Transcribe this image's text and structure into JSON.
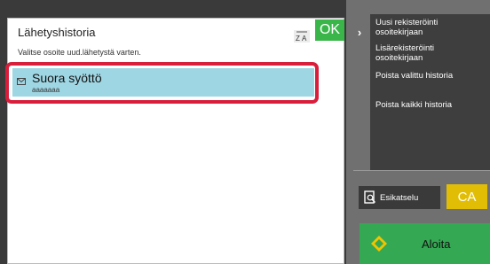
{
  "dialog": {
    "title": "Lähetyshistoria",
    "ok_label": "OK",
    "subtitle": "Valitse osoite uud.lähetystä varten."
  },
  "history_list": [
    {
      "name": "Suora syöttö",
      "address": "aaaaaaa",
      "icon": "mail-icon",
      "selected": true
    }
  ],
  "side_menu": {
    "items": [
      {
        "label_line1": "Uusi rekisteröinti",
        "label_line2": "osoitekirjaan"
      },
      {
        "label_line1": "Lisärekisteröinti",
        "label_line2": "osoitekirjaan"
      },
      {
        "label_line1": "Poista valittu historia",
        "label_line2": ""
      },
      {
        "label_line1": "Poista kaikki historia",
        "label_line2": ""
      }
    ]
  },
  "buttons": {
    "preview_label": "Esikatselu",
    "ca_label": "CA",
    "start_label": "Aloita"
  },
  "colors": {
    "ok": "#39b54a",
    "ca": "#e1be05",
    "start": "#34a853",
    "selected_row": "#9fd6e3",
    "selection_frame": "#d91e3c"
  }
}
